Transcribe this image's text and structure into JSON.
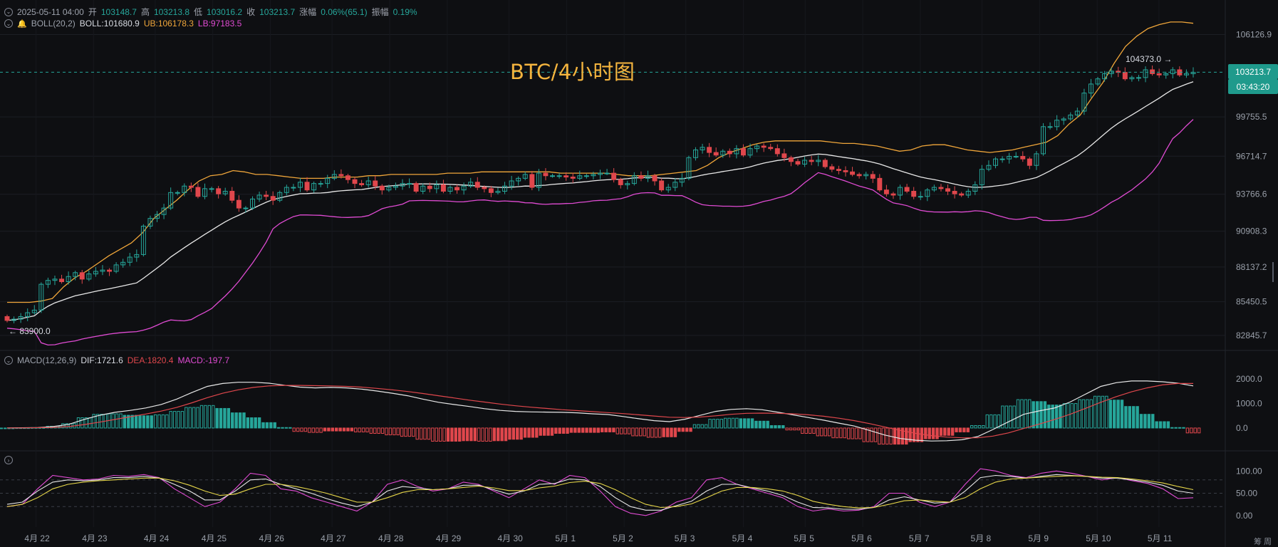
{
  "header": {
    "date": "2025-05-11 04:00",
    "open_label": "开",
    "open": "103148.7",
    "high_label": "高",
    "high": "103213.8",
    "low_label": "低",
    "low": "103016.2",
    "close_label": "收",
    "close": "103213.7",
    "change_label": "涨幅",
    "change": "0.06%(65.1)",
    "amp_label": "振幅",
    "amp": "0.19%"
  },
  "boll_header": {
    "name": "BOLL(20,2)",
    "mid": "BOLL:101680.9",
    "ub": "UB:106178.3",
    "lb": "LB:97183.5"
  },
  "macd_header": {
    "name": "MACD(12,26,9)",
    "dif": "DIF:1721.6",
    "dea": "DEA:1820.4",
    "macd": "MACD:-197.7"
  },
  "title": "BTC/4小时图",
  "current_price": "103213.7",
  "countdown": "03:43:20",
  "max_label": "104373.0 →",
  "min_label": "← 83900.0",
  "bottom_right": "筹 周",
  "colors": {
    "up": "#26a69a",
    "down": "#e0474c",
    "boll_mid": "#e8e8e8",
    "boll_ub": "#f0a63a",
    "boll_lb": "#e04bd3",
    "dif": "#e8e8e8",
    "dea": "#e0474c",
    "background": "#0e0f12",
    "grid": "#1c1e24"
  },
  "chart_data": [
    {
      "type": "candlestick",
      "title": "BTC/4小时图",
      "y_ticks": [
        "106126.9",
        "99755.5",
        "96714.7",
        "93766.6",
        "90908.3",
        "88137.2",
        "85450.5",
        "82845.7"
      ],
      "ylim": [
        81900,
        107700
      ],
      "x_ticks": [
        "4月 22",
        "4月 23",
        "4月 24",
        "4月 25",
        "4月 26",
        "4月 27",
        "4月 28",
        "4月 29",
        "4月 30",
        "5月 1",
        "5月 2",
        "5月 3",
        "5月 4",
        "5月 5",
        "5月 6",
        "5月 7",
        "5月 8",
        "5月 9",
        "5月 10",
        "5月 11"
      ],
      "x_tick_index": [
        7,
        21,
        36,
        50,
        64,
        79,
        93,
        107,
        122,
        136,
        150,
        165,
        179,
        194,
        208,
        222,
        237,
        251,
        265,
        280
      ],
      "close": [
        84000,
        84100,
        84300,
        84600,
        84800,
        86800,
        87100,
        87200,
        87000,
        87400,
        87700,
        87200,
        87600,
        87800,
        87900,
        87800,
        88300,
        88500,
        88900,
        89100,
        91300,
        91900,
        92200,
        92700,
        93900,
        93900,
        94400,
        94300,
        93600,
        94200,
        94200,
        93800,
        94000,
        93300,
        92700,
        92700,
        93400,
        93700,
        93600,
        93300,
        93900,
        94300,
        94300,
        94700,
        94100,
        94600,
        94600,
        95000,
        95300,
        95200,
        94900,
        94600,
        94500,
        94800,
        94400,
        94100,
        94300,
        94400,
        94600,
        94600,
        94000,
        94400,
        94200,
        94500,
        94000,
        94300,
        94100,
        94400,
        94700,
        94300,
        94200,
        93900,
        94000,
        94400,
        94800,
        95000,
        95300,
        94300,
        95400,
        95200,
        95200,
        95200,
        95100,
        95000,
        95200,
        95200,
        95300,
        95400,
        95400,
        94900,
        94500,
        94600,
        95200,
        95000,
        95200,
        94800,
        94100,
        94300,
        94700,
        95000,
        96600,
        97200,
        97400,
        97000,
        96800,
        97100,
        96900,
        97300,
        96800,
        97300,
        97500,
        97400,
        97300,
        96900,
        96600,
        96300,
        96100,
        96400,
        96300,
        96400,
        95900,
        95700,
        95600,
        95500,
        95300,
        95200,
        95300,
        95000,
        94100,
        93800,
        93700,
        94300,
        94000,
        93600,
        93600,
        94100,
        94300,
        94200,
        94000,
        93800,
        93700,
        94000,
        94500,
        95700,
        96000,
        96500,
        96500,
        96700,
        96700,
        96500,
        96000,
        96900,
        99000,
        99000,
        99500,
        99600,
        99900,
        100200,
        101600,
        102300,
        102700,
        103100,
        103300,
        103200,
        102700,
        102800,
        102800,
        103400,
        103100,
        103000,
        103100,
        103400,
        103000,
        103100,
        103200
      ],
      "boll_ub": [
        85400,
        85400,
        85400,
        85500,
        85700,
        86600,
        87300,
        87800,
        88400,
        89000,
        89500,
        90000,
        90800,
        91900,
        92600,
        93300,
        94100,
        94800,
        95200,
        95300,
        95600,
        95500,
        95300,
        95300,
        95200,
        95100,
        95000,
        95000,
        95000,
        95100,
        95100,
        95100,
        95200,
        95200,
        95300,
        95300,
        95300,
        95300,
        95300,
        95400,
        95400,
        95400,
        95500,
        95500,
        95500,
        95500,
        95500,
        95500,
        95500,
        95400,
        95400,
        95400,
        95400,
        95400,
        95300,
        95200,
        95200,
        95200,
        95300,
        95400,
        95500,
        95600,
        96000,
        96600,
        97000,
        97300,
        97600,
        97800,
        97900,
        97900,
        97900,
        97900,
        97900,
        97800,
        97700,
        97700,
        97600,
        97500,
        97300,
        97100,
        97200,
        97500,
        97600,
        97600,
        97400,
        97200,
        97100,
        97000,
        97100,
        97200,
        97400,
        97600,
        97800,
        98300,
        99200,
        99900,
        101200,
        102400,
        103900,
        105200,
        106000,
        106600,
        106900,
        107100,
        107100,
        107000
      ]
    },
    {
      "type": "macd",
      "title": "MACD(12,26,9)",
      "y_ticks": [
        "2000.0",
        "1000.0",
        "0.0"
      ],
      "ylim": [
        -700,
        2500
      ],
      "dif": [
        0,
        10,
        20,
        60,
        150,
        350,
        520,
        640,
        720,
        820,
        960,
        1180,
        1450,
        1700,
        1820,
        1870,
        1870,
        1830,
        1750,
        1670,
        1640,
        1660,
        1640,
        1590,
        1510,
        1420,
        1320,
        1180,
        1050,
        960,
        880,
        790,
        720,
        680,
        660,
        650,
        640,
        620,
        580,
        550,
        470,
        380,
        300,
        260,
        360,
        520,
        680,
        760,
        790,
        750,
        650,
        540,
        430,
        320,
        200,
        80,
        -100,
        -290,
        -430,
        -500,
        -530,
        -520,
        -480,
        -350,
        -60,
        250,
        560,
        700,
        820,
        1060,
        1380,
        1700,
        1850,
        1920,
        1920,
        1890,
        1830,
        1720
      ],
      "dea": [
        0,
        5,
        12,
        25,
        60,
        140,
        240,
        350,
        460,
        570,
        690,
        840,
        1030,
        1240,
        1420,
        1560,
        1660,
        1720,
        1740,
        1740,
        1730,
        1720,
        1700,
        1670,
        1620,
        1560,
        1490,
        1410,
        1320,
        1230,
        1140,
        1060,
        980,
        910,
        850,
        800,
        750,
        710,
        670,
        630,
        590,
        540,
        490,
        440,
        430,
        450,
        500,
        560,
        600,
        610,
        600,
        580,
        540,
        480,
        400,
        300,
        180,
        40,
        -100,
        -220,
        -310,
        -370,
        -400,
        -400,
        -330,
        -200,
        -20,
        160,
        350,
        560,
        800,
        1050,
        1280,
        1480,
        1640,
        1760,
        1820,
        1820
      ],
      "macd_step_bars": 4
    },
    {
      "type": "line",
      "title": "",
      "y_ticks": [
        "100.00",
        "50.00",
        "0.00"
      ],
      "ylim": [
        -10,
        110
      ],
      "ref_lines": [
        80,
        50,
        20
      ],
      "series": [
        {
          "color": "#e04bd3",
          "values": [
            20,
            25,
            60,
            90,
            85,
            80,
            82,
            90,
            88,
            92,
            85,
            60,
            40,
            20,
            30,
            60,
            95,
            90,
            60,
            55,
            40,
            30,
            20,
            10,
            30,
            70,
            80,
            65,
            55,
            60,
            75,
            70,
            55,
            40,
            60,
            80,
            70,
            90,
            85,
            55,
            20,
            5,
            0,
            10,
            30,
            40,
            80,
            85,
            70,
            60,
            50,
            40,
            20,
            10,
            15,
            10,
            12,
            20,
            50,
            50,
            30,
            20,
            30,
            70,
            105,
            100,
            90,
            85,
            95,
            100,
            95,
            88,
            80,
            85,
            78,
            72,
            60,
            38,
            40
          ]
        },
        {
          "color": "#e8e8e8",
          "values": [
            25,
            30,
            55,
            75,
            80,
            78,
            80,
            85,
            85,
            88,
            84,
            70,
            55,
            35,
            35,
            55,
            80,
            82,
            70,
            60,
            50,
            38,
            28,
            20,
            30,
            55,
            65,
            62,
            58,
            60,
            68,
            68,
            58,
            48,
            55,
            70,
            72,
            82,
            80,
            65,
            40,
            20,
            12,
            12,
            22,
            32,
            55,
            70,
            70,
            62,
            55,
            45,
            30,
            18,
            17,
            14,
            14,
            18,
            35,
            42,
            35,
            28,
            30,
            55,
            85,
            90,
            88,
            84,
            88,
            92,
            90,
            88,
            84,
            84,
            80,
            75,
            68,
            55,
            50
          ]
        },
        {
          "color": "#e8d84a",
          "values": [
            20,
            25,
            40,
            60,
            70,
            75,
            78,
            80,
            82,
            84,
            84,
            78,
            68,
            55,
            45,
            48,
            60,
            70,
            70,
            65,
            58,
            50,
            40,
            30,
            30,
            40,
            52,
            58,
            58,
            60,
            63,
            66,
            62,
            56,
            56,
            62,
            66,
            74,
            77,
            72,
            58,
            40,
            25,
            18,
            20,
            26,
            40,
            55,
            63,
            63,
            60,
            55,
            45,
            32,
            25,
            20,
            17,
            18,
            25,
            33,
            35,
            32,
            30,
            40,
            60,
            75,
            82,
            84,
            86,
            88,
            89,
            88,
            86,
            85,
            82,
            78,
            73,
            65,
            58
          ]
        }
      ],
      "x_ticks": [
        "4月 22",
        "4月 23",
        "4月 24",
        "4月 25",
        "4月 26",
        "4月 27",
        "4月 28",
        "4月 29",
        "4月 30",
        "5月 1",
        "5月 2",
        "5月 3",
        "5月 4",
        "5月 5",
        "5月 6",
        "5月 7",
        "5月 8",
        "5月 9",
        "5月 10",
        "5月 11"
      ]
    }
  ]
}
